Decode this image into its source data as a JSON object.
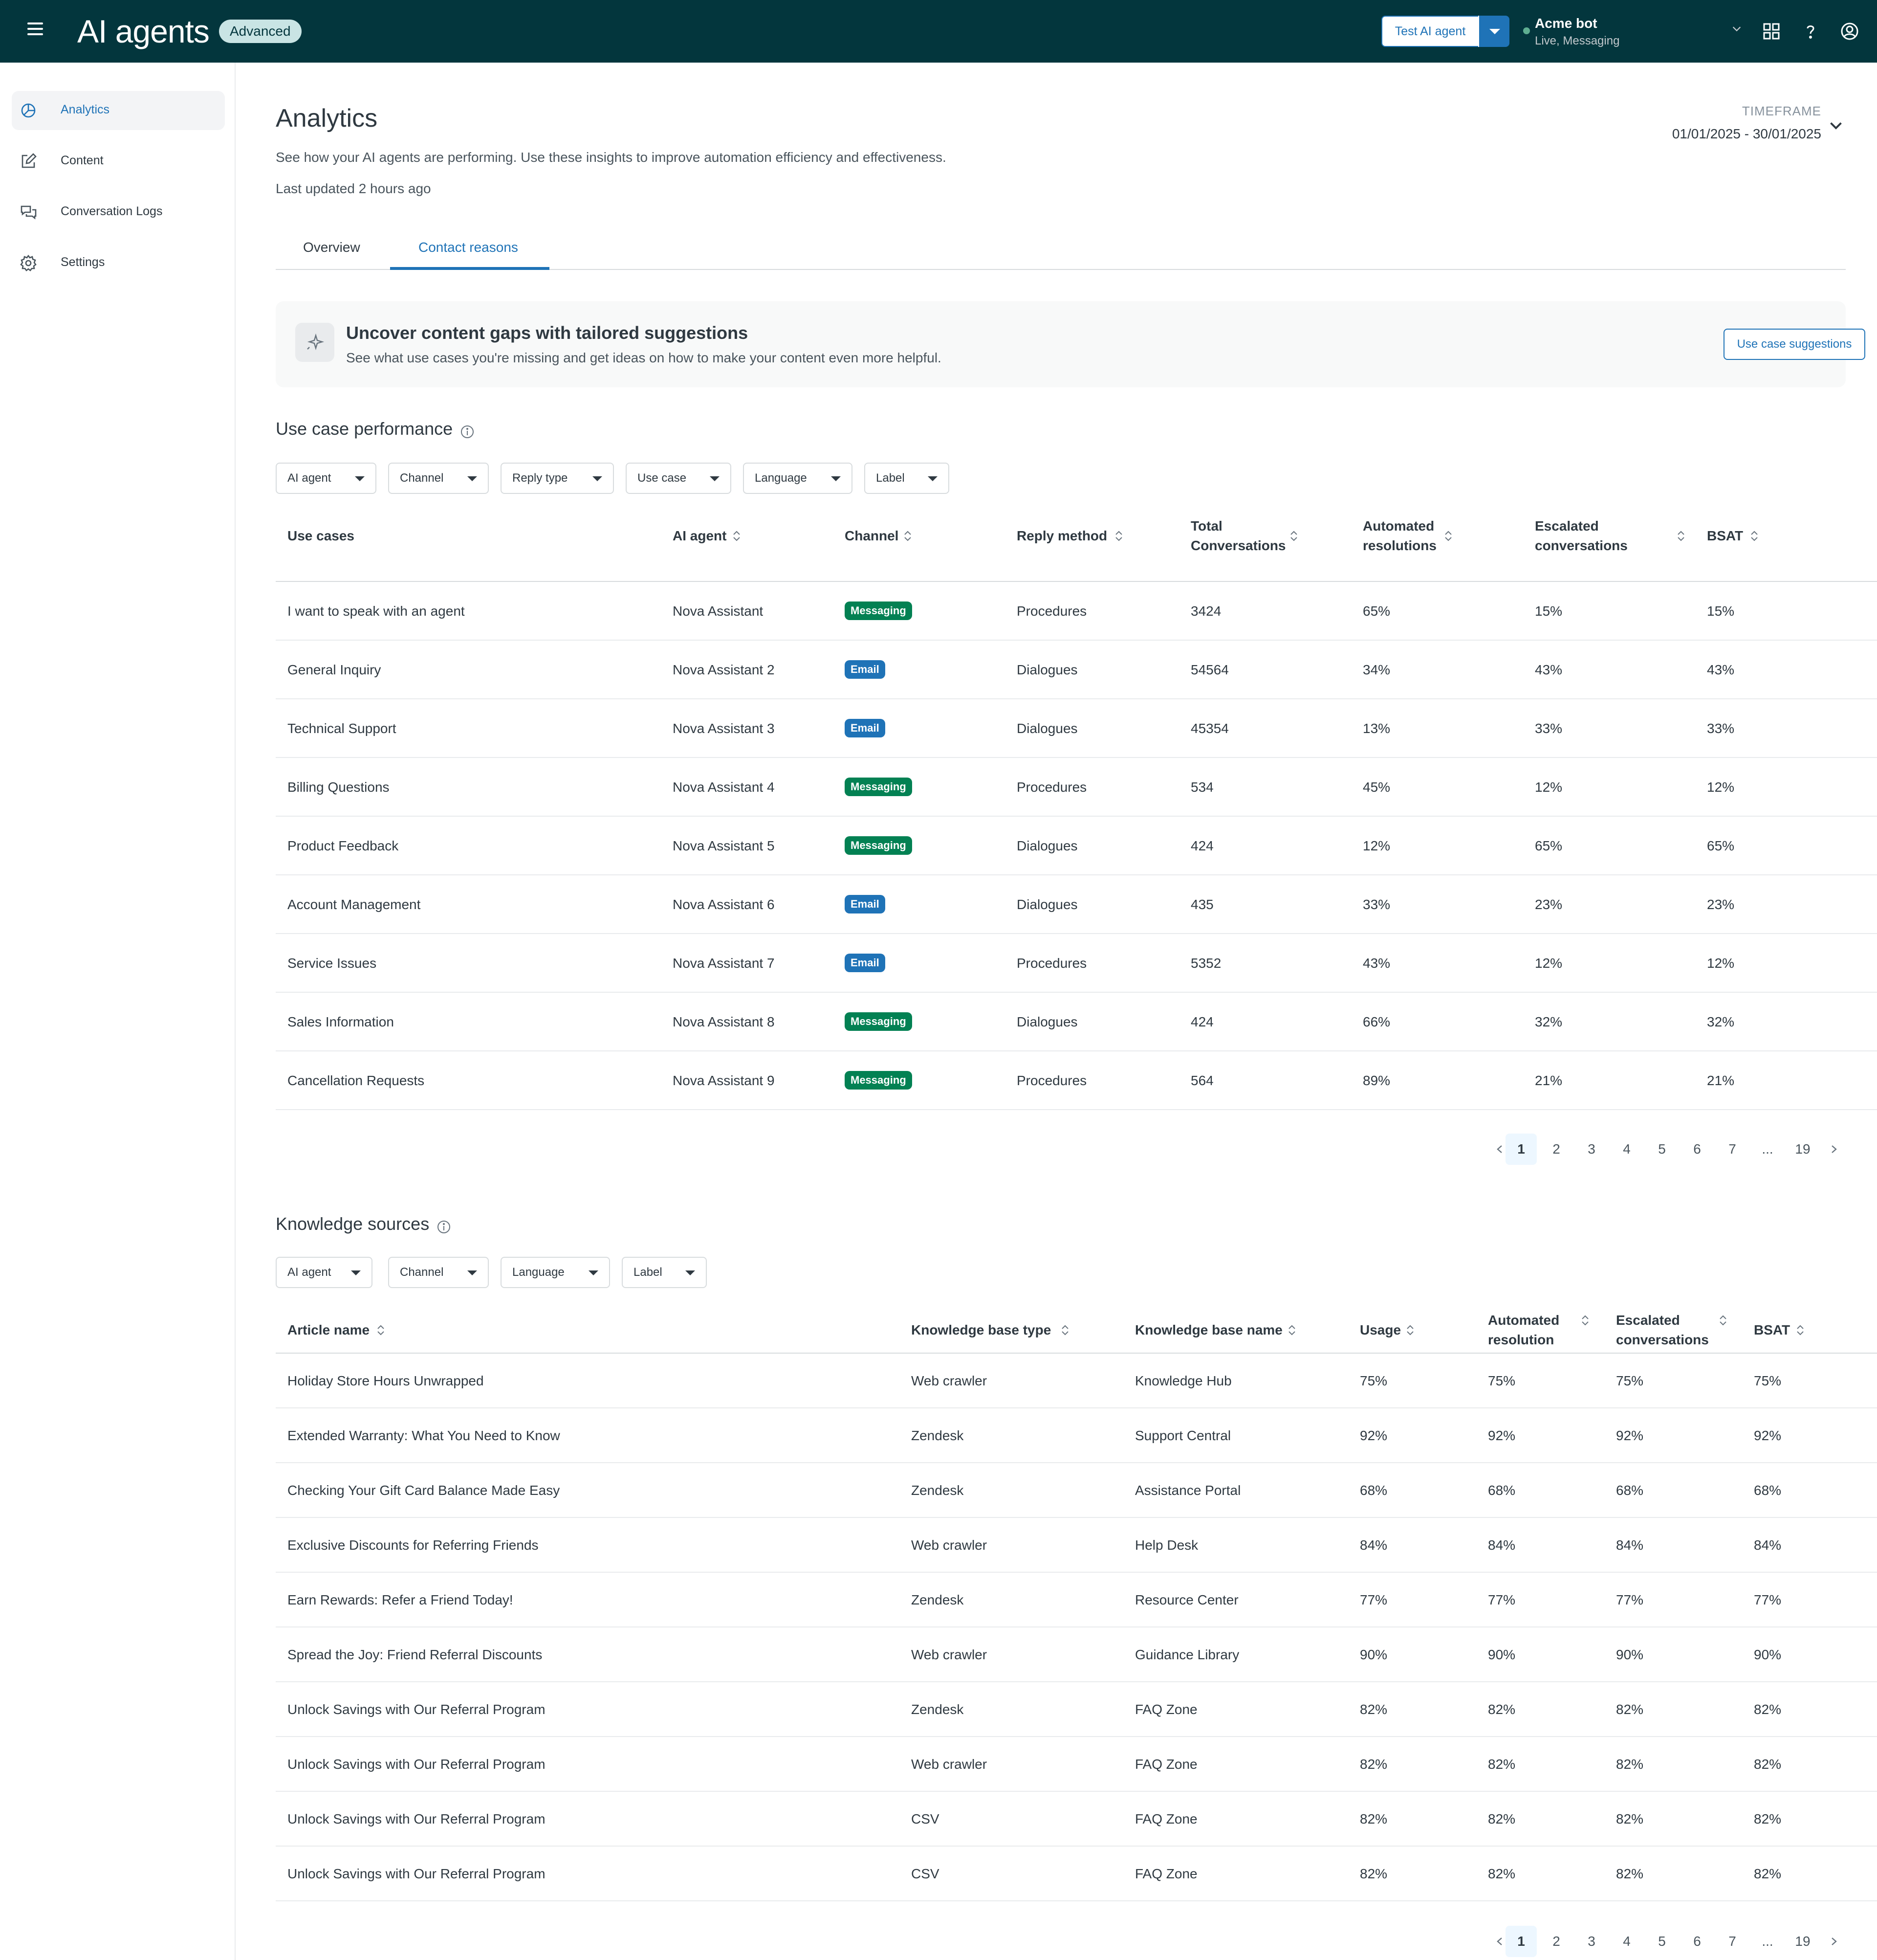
{
  "header": {
    "app_title": "AI agents",
    "plan_badge": "Advanced",
    "test_button": "Test AI agent",
    "bot_name": "Acme bot",
    "bot_status": "Live, Messaging"
  },
  "sidebar": {
    "items": [
      {
        "label": "Analytics",
        "icon": "analytics-icon",
        "active": true
      },
      {
        "label": "Content",
        "icon": "edit-icon"
      },
      {
        "label": "Conversation Logs",
        "icon": "chat-icon"
      },
      {
        "label": "Settings",
        "icon": "gear-icon"
      }
    ]
  },
  "page": {
    "title": "Analytics",
    "description": "See how your AI agents are performing. Use these insights to improve automation efficiency and effectiveness.",
    "updated": "Last updated 2 hours ago",
    "timeframe_label": "TIMEFRAME",
    "timeframe_value": "01/01/2025 - 30/01/2025",
    "tabs": [
      "Overview",
      "Contact reasons"
    ],
    "active_tab": "Contact reasons"
  },
  "promo": {
    "title": "Uncover content gaps with tailored suggestions",
    "subtitle": "See what use cases you're missing and get ideas on how to make your content even more helpful.",
    "button": "Use case suggestions"
  },
  "use_case_performance": {
    "title": "Use case performance",
    "filters": [
      "AI agent",
      "Channel",
      "Reply type",
      "Use case",
      "Language",
      "Label"
    ],
    "columns": [
      "Use cases",
      "AI agent",
      "Channel",
      "Reply method",
      "Total Conversations",
      "Automated resolutions",
      "Escalated conversations",
      "BSAT"
    ],
    "rows": [
      {
        "use_case": "I want to speak with an agent",
        "agent": "Nova Assistant",
        "channel": "Messaging",
        "method": "Procedures",
        "total": "3424",
        "automated": "65%",
        "escalated": "15%",
        "bsat": "15%"
      },
      {
        "use_case": "General Inquiry",
        "agent": "Nova Assistant 2",
        "channel": "Email",
        "method": "Dialogues",
        "total": "54564",
        "automated": "34%",
        "escalated": "43%",
        "bsat": "43%"
      },
      {
        "use_case": "Technical Support",
        "agent": "Nova Assistant 3",
        "channel": "Email",
        "method": "Dialogues",
        "total": "45354",
        "automated": "13%",
        "escalated": "33%",
        "bsat": "33%"
      },
      {
        "use_case": "Billing Questions",
        "agent": "Nova Assistant 4",
        "channel": "Messaging",
        "method": "Procedures",
        "total": "534",
        "automated": "45%",
        "escalated": "12%",
        "bsat": "12%"
      },
      {
        "use_case": "Product Feedback",
        "agent": "Nova Assistant 5",
        "channel": "Messaging",
        "method": "Dialogues",
        "total": "424",
        "automated": "12%",
        "escalated": "65%",
        "bsat": "65%"
      },
      {
        "use_case": "Account Management",
        "agent": "Nova Assistant 6",
        "channel": "Email",
        "method": "Dialogues",
        "total": "435",
        "automated": "33%",
        "escalated": "23%",
        "bsat": "23%"
      },
      {
        "use_case": "Service Issues",
        "agent": "Nova Assistant 7",
        "channel": "Email",
        "method": "Procedures",
        "total": "5352",
        "automated": "43%",
        "escalated": "12%",
        "bsat": "12%"
      },
      {
        "use_case": "Sales Information",
        "agent": "Nova Assistant 8",
        "channel": "Messaging",
        "method": "Dialogues",
        "total": "424",
        "automated": "66%",
        "escalated": "32%",
        "bsat": "32%"
      },
      {
        "use_case": "Cancellation Requests",
        "agent": "Nova Assistant 9",
        "channel": "Messaging",
        "method": "Procedures",
        "total": "564",
        "automated": "89%",
        "escalated": "21%",
        "bsat": "21%"
      }
    ],
    "pagination": [
      "1",
      "2",
      "3",
      "4",
      "5",
      "6",
      "7",
      "...",
      "19"
    ],
    "current_page": "1"
  },
  "knowledge_sources": {
    "title": "Knowledge sources",
    "filters": [
      "AI agent",
      "Channel",
      "Language",
      "Label"
    ],
    "columns": [
      "Article name",
      "Knowledge base type",
      "Knowledge base name",
      "Usage",
      "Automated resolution",
      "Escalated conversations",
      "BSAT"
    ],
    "rows": [
      {
        "article": "Holiday Store Hours Unwrapped",
        "kb_type": "Web crawler",
        "kb_name": "Knowledge Hub",
        "usage": "75%",
        "automated": "75%",
        "escalated": "75%",
        "bsat": "75%"
      },
      {
        "article": "Extended Warranty: What You Need to Know",
        "kb_type": "Zendesk",
        "kb_name": "Support Central",
        "usage": "92%",
        "automated": "92%",
        "escalated": "92%",
        "bsat": "92%"
      },
      {
        "article": "Checking Your Gift Card Balance Made Easy",
        "kb_type": "Zendesk",
        "kb_name": "Assistance Portal",
        "usage": "68%",
        "automated": "68%",
        "escalated": "68%",
        "bsat": "68%"
      },
      {
        "article": "Exclusive Discounts for Referring Friends",
        "kb_type": "Web crawler",
        "kb_name": "Help Desk",
        "usage": "84%",
        "automated": "84%",
        "escalated": "84%",
        "bsat": "84%"
      },
      {
        "article": "Earn Rewards: Refer a Friend Today!",
        "kb_type": "Zendesk",
        "kb_name": "Resource Center",
        "usage": "77%",
        "automated": "77%",
        "escalated": "77%",
        "bsat": "77%"
      },
      {
        "article": "Spread the Joy: Friend Referral Discounts",
        "kb_type": "Web crawler",
        "kb_name": "Guidance Library",
        "usage": "90%",
        "automated": "90%",
        "escalated": "90%",
        "bsat": "90%"
      },
      {
        "article": "Unlock Savings with Our Referral Program",
        "kb_type": "Zendesk",
        "kb_name": "FAQ Zone",
        "usage": "82%",
        "automated": "82%",
        "escalated": "82%",
        "bsat": "82%"
      },
      {
        "article": "Unlock Savings with Our Referral Program",
        "kb_type": "Web crawler",
        "kb_name": "FAQ Zone",
        "usage": "82%",
        "automated": "82%",
        "escalated": "82%",
        "bsat": "82%"
      },
      {
        "article": "Unlock Savings with Our Referral Program",
        "kb_type": "CSV",
        "kb_name": "FAQ Zone",
        "usage": "82%",
        "automated": "82%",
        "escalated": "82%",
        "bsat": "82%"
      },
      {
        "article": "Unlock Savings with Our Referral Program",
        "kb_type": "CSV",
        "kb_name": "FAQ Zone",
        "usage": "82%",
        "automated": "82%",
        "escalated": "82%",
        "bsat": "82%"
      }
    ],
    "pagination": [
      "1",
      "2",
      "3",
      "4",
      "5",
      "6",
      "7",
      "...",
      "19"
    ],
    "current_page": "1"
  },
  "colors": {
    "header_bg": "#03363d",
    "accent": "#1f73b7",
    "messaging_chip": "#038153",
    "email_chip": "#1f73b7"
  }
}
